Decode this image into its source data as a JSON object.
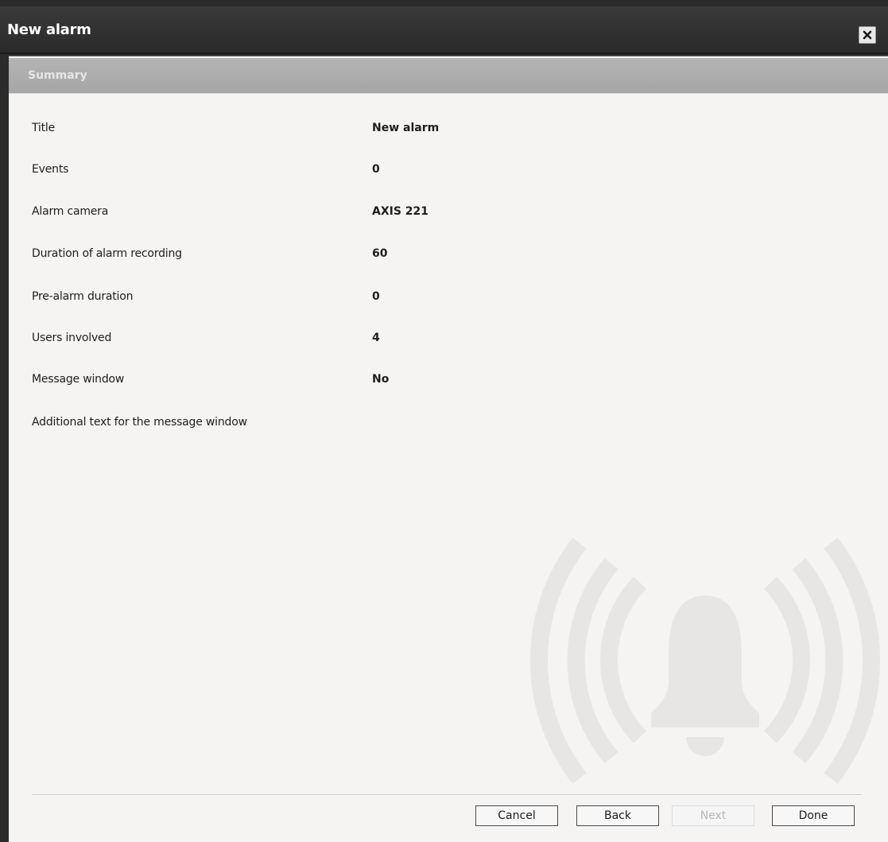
{
  "window": {
    "title": "New alarm",
    "close_icon": "close-icon"
  },
  "section": {
    "title": "Summary"
  },
  "summary": [
    {
      "label": "Title",
      "value": "New alarm"
    },
    {
      "label": "Events",
      "value": "0"
    },
    {
      "label": "Alarm camera",
      "value": "AXIS 221"
    },
    {
      "label": "Duration of alarm recording",
      "value": "60"
    },
    {
      "label": "Pre-alarm duration",
      "value": "0"
    },
    {
      "label": "Users involved",
      "value": "4"
    },
    {
      "label": "Message window",
      "value": "No"
    },
    {
      "label": "Additional text for the message window",
      "value": ""
    }
  ],
  "watermark_icon": "alarm-bell-icon",
  "buttons": {
    "cancel": "Cancel",
    "back": "Back",
    "next": "Next",
    "done": "Done"
  },
  "colors": {
    "titlebar": "#2b2b2b",
    "section_header": "#a8a8a8",
    "panel": "#f5f4f2",
    "watermark": "#e6e5e3"
  }
}
